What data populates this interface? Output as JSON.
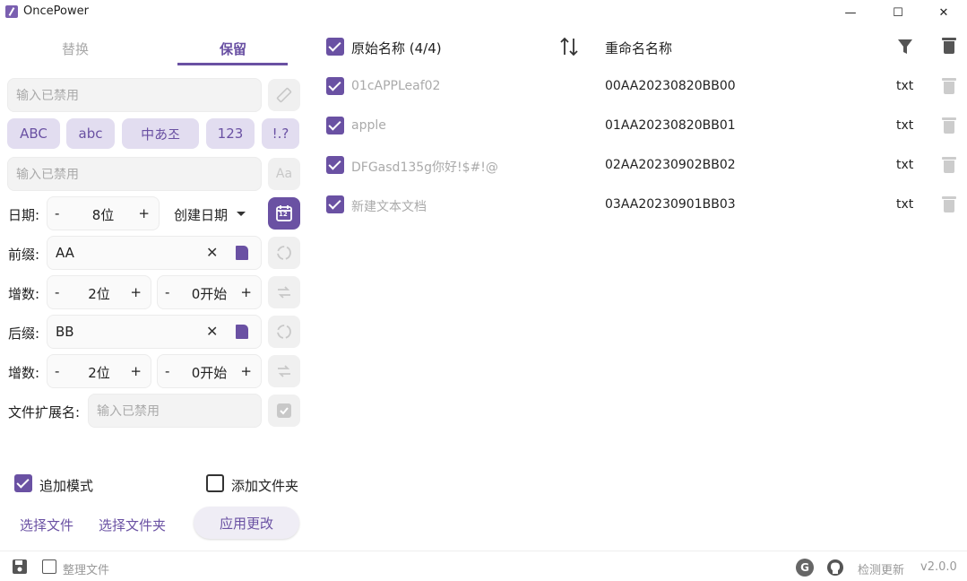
{
  "window": {
    "title": "OncePower",
    "min_glyph": "—",
    "max_glyph": "☐",
    "close_glyph": "✕"
  },
  "tabs": [
    {
      "label": "替换"
    },
    {
      "label": "保留"
    }
  ],
  "left": {
    "input1_placeholder": "输入已禁用",
    "filters": [
      "ABC",
      "abc",
      "中あ조",
      "123",
      "!.?"
    ],
    "input2_placeholder": "输入已禁用",
    "font_btn_glyph": "Aa",
    "date": {
      "label": "日期:",
      "minus": "-",
      "value": "8位",
      "plus": "+",
      "type": "创建日期",
      "cal_day": "12"
    },
    "prefix": {
      "label": "前缀:",
      "value": "AA",
      "clear": "✕"
    },
    "inc1": {
      "label": "增数:",
      "digits": "2位",
      "start": "0开始",
      "minus": "-",
      "plus": "+"
    },
    "suffix": {
      "label": "后缀:",
      "value": "BB",
      "clear": "✕"
    },
    "inc2": {
      "label": "增数:",
      "digits": "2位",
      "start": "0开始",
      "minus": "-",
      "plus": "+"
    },
    "ext": {
      "label": "文件扩展名:",
      "placeholder": "输入已禁用"
    },
    "append_mode": "追加模式",
    "add_folder": "添加文件夹",
    "select_files": "选择文件",
    "select_folder": "选择文件夹",
    "apply": "应用更改"
  },
  "table": {
    "header_original": "原始名称 (4/4)",
    "header_renamed": "重命名名称",
    "rows": [
      {
        "original": "01cAPPLeaf02",
        "renamed": "00AA20230820BB00",
        "ext": "txt"
      },
      {
        "original": "apple",
        "renamed": "01AA20230820BB01",
        "ext": "txt"
      },
      {
        "original": "DFGasd135g你好!$#!@",
        "renamed": "02AA20230902BB02",
        "ext": "txt"
      },
      {
        "original": "新建文本文档",
        "renamed": "03AA20230901BB03",
        "ext": "txt"
      }
    ]
  },
  "status": {
    "organize": "整理文件",
    "check_update": "检测更新",
    "version": "v2.0.0",
    "g_glyph": "G"
  },
  "colors": {
    "accent": "#6a51a3",
    "pill_bg": "#e2ddf0",
    "disabled_text": "#aaaaaa"
  }
}
